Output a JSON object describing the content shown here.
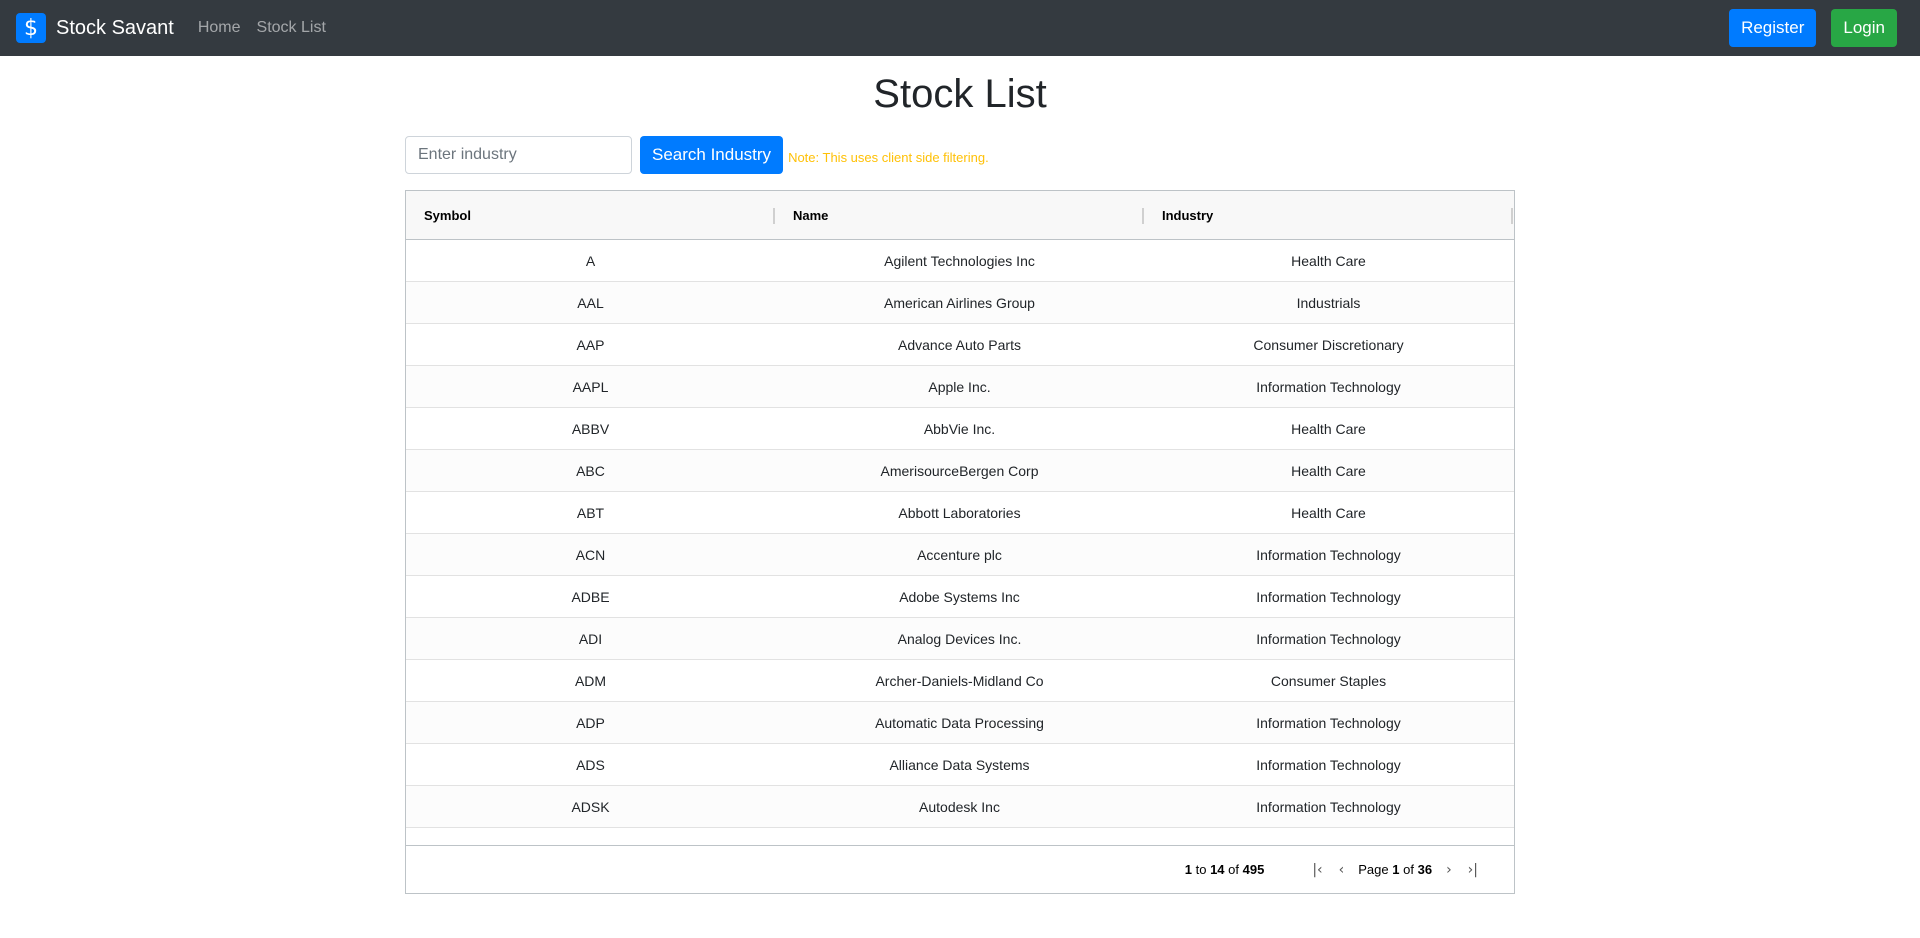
{
  "nav": {
    "brand_icon": "$",
    "brand": "Stock Savant",
    "links": [
      "Home",
      "Stock List"
    ],
    "register": "Register",
    "login": "Login"
  },
  "page": {
    "title": "Stock List"
  },
  "search": {
    "placeholder": "Enter industry",
    "button": "Search Industry",
    "note": "Note: This uses client side filtering."
  },
  "grid": {
    "columns": [
      "Symbol",
      "Name",
      "Industry"
    ],
    "rows": [
      [
        "A",
        "Agilent Technologies Inc",
        "Health Care"
      ],
      [
        "AAL",
        "American Airlines Group",
        "Industrials"
      ],
      [
        "AAP",
        "Advance Auto Parts",
        "Consumer Discretionary"
      ],
      [
        "AAPL",
        "Apple Inc.",
        "Information Technology"
      ],
      [
        "ABBV",
        "AbbVie Inc.",
        "Health Care"
      ],
      [
        "ABC",
        "AmerisourceBergen Corp",
        "Health Care"
      ],
      [
        "ABT",
        "Abbott Laboratories",
        "Health Care"
      ],
      [
        "ACN",
        "Accenture plc",
        "Information Technology"
      ],
      [
        "ADBE",
        "Adobe Systems Inc",
        "Information Technology"
      ],
      [
        "ADI",
        "Analog Devices Inc.",
        "Information Technology"
      ],
      [
        "ADM",
        "Archer-Daniels-Midland Co",
        "Consumer Staples"
      ],
      [
        "ADP",
        "Automatic Data Processing",
        "Information Technology"
      ],
      [
        "ADS",
        "Alliance Data Systems",
        "Information Technology"
      ],
      [
        "ADSK",
        "Autodesk Inc",
        "Information Technology"
      ]
    ]
  },
  "pagination": {
    "from": "1",
    "to_word": "to",
    "to": "14",
    "of_word": "of",
    "total": "495",
    "page_word": "Page",
    "page": "1",
    "pages": "36"
  },
  "colors": {
    "navbar": "#343a40",
    "primary": "#007bff",
    "success": "#28a745",
    "note": "#ffc107"
  }
}
